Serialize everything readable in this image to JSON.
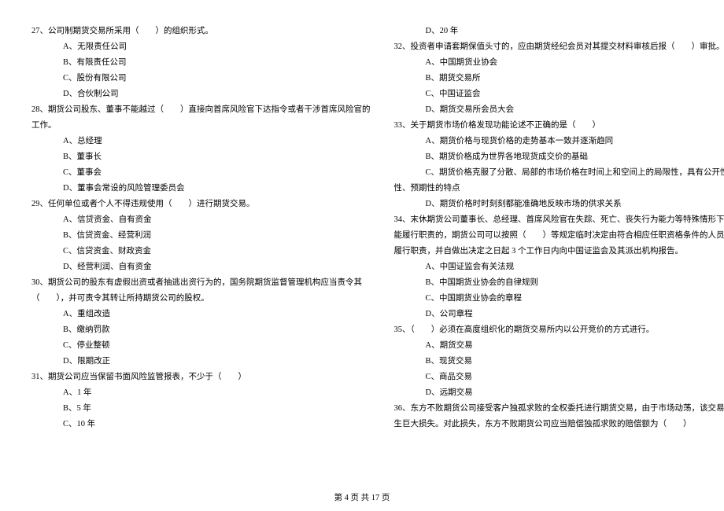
{
  "questions": [
    {
      "num": "27",
      "text": "公司制期货交易所采用（　　）的组织形式。",
      "options": [
        "A、无限责任公司",
        "B、有限责任公司",
        "C、股份有限公司",
        "D、合伙制公司"
      ]
    },
    {
      "num": "28",
      "text": "期货公司股东、董事不能越过（　　）直接向首席风险官下达指令或者干涉首席风险官的",
      "text2": "工作。",
      "options": [
        "A、总经理",
        "B、董事长",
        "C、董事会",
        "D、董事会常设的风险管理委员会"
      ]
    },
    {
      "num": "29",
      "text": "任何单位或者个人不得违规使用（　　）进行期货交易。",
      "options": [
        "A、信贷资金、自有资金",
        "B、信贷资金、经营利润",
        "C、信贷资金、财政资金",
        "D、经营利润、自有资金"
      ]
    },
    {
      "num": "30",
      "text": "期货公司的股东有虚假出资或者抽逃出资行为的，国务院期货监督管理机构应当责令其",
      "text2": "（　　），并可责令其转让所持期货公司的股权。",
      "options": [
        "A、重组改造",
        "B、缴纳罚款",
        "C、停业整顿",
        "D、限期改正"
      ]
    },
    {
      "num": "31",
      "text": "期货公司应当保留书面风险监管报表，不少于（　　）",
      "options": [
        "A、1 年",
        "B、5 年",
        "C、10 年"
      ]
    }
  ],
  "rightColumn": {
    "q31_d": "D、20 年",
    "q32": {
      "num": "32",
      "text": "投资者申请套期保值头寸的，应由期货经纪会员对其提交材料审核后报（　　）审批。",
      "options": [
        "A、中国期货业协会",
        "B、期货交易所",
        "C、中国证监会",
        "D、期货交易所会员大会"
      ]
    },
    "q33": {
      "num": "33",
      "text": "关于期货市场价格发现功能论述不正确的是（　　）",
      "options": [
        "A、期货价格与现货价格的走势基本一致并逐渐趋同",
        "B、期货价格成为世界各地现货成交价的基础",
        "C、期货价格克服了分散、局部的市场价格在时间上和空间上的局限性，具有公开性、连续"
      ],
      "c_line2": "性、预期性的特点",
      "option_d": "D、期货价格时时刻刻都能准确地反映市场的供求关系"
    },
    "q34": {
      "num": "34",
      "text": "末休期货公司董事长、总经理、首席风险官在失踪、死亡、丧失行为能力等特殊情形下不",
      "text2": "能履行职责的，期货公司可以按照（　　）等规定临时决定由符合相应任职资格条件的人员代为",
      "text3": "履行职责，并自做出决定之日起 3 个工作日内向中国证监会及其派出机构报告。",
      "options": [
        "A、中国证监会有关法规",
        "B、中国期货业协会的自律规则",
        "C、中国期货业协会的章程",
        "D、公司章程"
      ]
    },
    "q35": {
      "num": "35",
      "text": "（　　）必须在高度组织化的期货交易所内以公开竞价的方式进行。",
      "options": [
        "A、期货交易",
        "B、现货交易",
        "C、商品交易",
        "D、远期交易"
      ]
    },
    "q36": {
      "num": "36",
      "text": "东方不败期货公司接受客户独孤求败的全权委托进行期货交易，由于市场动荡，该交易产",
      "text2": "生巨大损失。对此损失，东方不败期货公司应当赔偿独孤求败的赔偿额为（　　）"
    }
  },
  "footer": "第 4 页 共 17 页"
}
